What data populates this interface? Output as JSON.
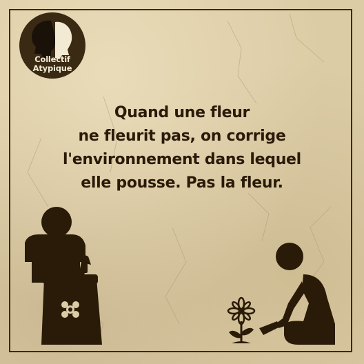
{
  "logo": {
    "line1": "Collectif",
    "line2": "Atypique",
    "icon": "two-heads-profile-icon"
  },
  "quote": {
    "lines": [
      "Quand une fleur",
      "ne fleurit pas, on corrige",
      "l'environnement dans lequel",
      "elle pousse. Pas la fleur."
    ]
  },
  "illustrations": {
    "left": "person-with-soil-bag-icon",
    "bag_emblem": "flower-emblem-icon",
    "right": "kneeling-gardener-icon",
    "plant": "daisy-flower-icon"
  },
  "colors": {
    "ink": "#2a1a08",
    "paper": "#dccca6",
    "logo_text": "#f3ead4"
  }
}
